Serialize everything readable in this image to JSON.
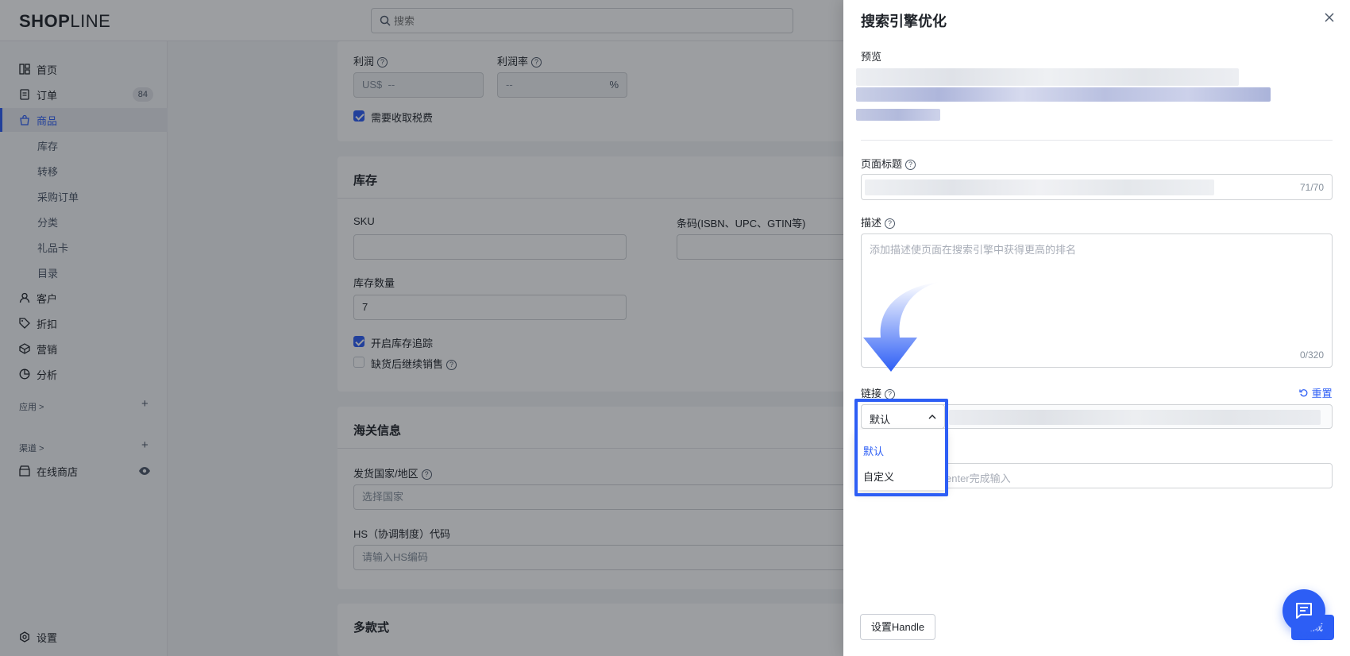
{
  "app": {
    "logo_bold": "SHOP",
    "logo_thin": "LINE"
  },
  "search": {
    "placeholder": "搜索"
  },
  "sidebar": {
    "items": [
      {
        "label": "首页",
        "icon": "dashboard-icon"
      },
      {
        "label": "订单",
        "icon": "order-icon",
        "badge": "84"
      },
      {
        "label": "商品",
        "icon": "bag-icon"
      },
      {
        "label": "库存"
      },
      {
        "label": "转移"
      },
      {
        "label": "采购订单"
      },
      {
        "label": "分类"
      },
      {
        "label": "礼品卡"
      },
      {
        "label": "目录"
      },
      {
        "label": "客户",
        "icon": "person-icon"
      },
      {
        "label": "折扣",
        "icon": "tag-icon"
      },
      {
        "label": "营销",
        "icon": "megaphone-icon"
      },
      {
        "label": "分析",
        "icon": "chart-icon"
      }
    ],
    "apps_label": "应用 >",
    "channels_label": "渠道 >",
    "online_store": "在线商店",
    "settings": "设置"
  },
  "profit": {
    "label": "利润",
    "currency": "US$",
    "value": "--",
    "rate_label": "利润率",
    "rate_value": "--",
    "rate_unit": "%",
    "tax_label": "需要收取税费"
  },
  "inventory": {
    "title": "库存",
    "sku_label": "SKU",
    "barcode_label": "条码(ISBN、UPC、GTIN等)",
    "qty_label": "库存数量",
    "qty_value": "7",
    "track_label": "开启库存追踪",
    "oversell_label": "缺货后继续销售"
  },
  "customs": {
    "title": "海关信息",
    "country_label": "发货国家/地区",
    "country_placeholder": "选择国家",
    "hs_label": "HS（协调制度）代码",
    "hs_placeholder": "请输入HS编码"
  },
  "variants": {
    "title": "多款式"
  },
  "drawer": {
    "title": "搜索引擎优化",
    "preview_label": "预览",
    "page_title_label": "页面标题",
    "page_title_count": "71/70",
    "desc_label": "描述",
    "desc_placeholder": "添加描述使页面在搜索引擎中获得更高的排名",
    "desc_count": "0/320",
    "link_label": "链接",
    "reset_label": "重置",
    "select_value": "默认",
    "options": [
      "默认",
      "自定义"
    ],
    "keyword_placeholder": "enter完成输入",
    "handle_button": "设置Handle",
    "save_button": "完成"
  },
  "colors": {
    "accent": "#2d5ef5",
    "overlay": "rgba(20,24,32,0.42)"
  }
}
